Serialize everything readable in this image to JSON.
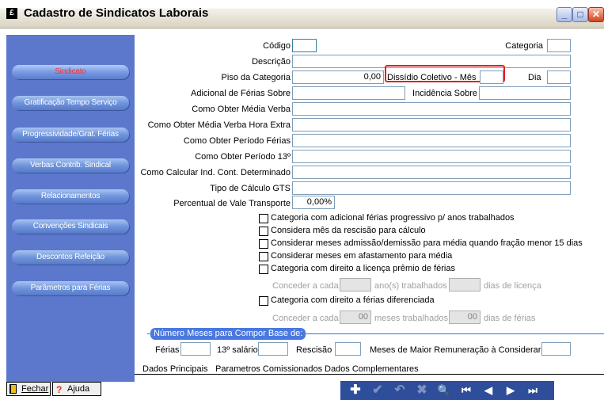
{
  "window": {
    "title": "Cadastro de Sindicatos Laborais",
    "icon_glyph": "£"
  },
  "sidebar": {
    "items": [
      {
        "label": "Sindicato"
      },
      {
        "label": "Gratificação Tempo Serviço"
      },
      {
        "label": "Progressividade/Grat. Férias"
      },
      {
        "label": "Verbas Contrib. Sindical"
      },
      {
        "label": "Relacionamentos"
      },
      {
        "label": "Convenções Sindicais"
      },
      {
        "label": "Descontos Refeição"
      },
      {
        "label": "Parâmetros para Férias"
      }
    ],
    "fechar_label": "Fechar",
    "ajuda_label": "Ajuda"
  },
  "form": {
    "codigo_label": "Código",
    "categoria_label": "Categoria",
    "descricao_label": "Descrição",
    "piso_label": "Piso da Categoria",
    "piso_value": "0,00",
    "dissidio_label": "Dissídio Coletivo - Mês",
    "dia_label": "Dia",
    "adicional_label": "Adicional de Férias Sobre",
    "incidencia_label": "Incidência Sobre",
    "media_verba_label": "Como Obter Média Verba",
    "media_verba_hora_label": "Como Obter Média Verba Hora Extra",
    "periodo_ferias_label": "Como Obter Período Férias",
    "periodo_13_label": "Como Obter Período 13º",
    "ind_cont_label": "Como Calcular Ind. Cont. Determinado",
    "tipo_gts_label": "Tipo de Cálculo GTS",
    "vale_transporte_label": "Percentual de Vale Transporte",
    "vale_transporte_value": "0,00%"
  },
  "checkboxes": [
    "Categoria com adicional férias progressivo p/ anos trabalhados",
    "Considera mês da rescisão para cálculo",
    "Considerar meses admissão/demissão para média quando fração menor 15 dias",
    "Considerar meses em afastamento para média",
    "Categoria com direito a licença prêmio de férias"
  ],
  "licenca": {
    "conceder_label": "Conceder a cada",
    "anos_label": "ano(s) trabalhados",
    "dias_label": "dias de licença"
  },
  "ferias_diferenciada": {
    "checkbox_label": "Categoria com direito a férias diferenciada",
    "conceder_label": "Conceder a cada",
    "meses_value": "00",
    "meses_label": "meses trabalhados",
    "dias_value": "00",
    "dias_label": "dias de férias"
  },
  "base": {
    "group_title": "Número Meses para Compor Base de:",
    "ferias_label": "Férias",
    "decimo_label": "13º salário",
    "rescisao_label": "Rescisão",
    "meses_maior_label": "Meses de Maior Remuneração à Considerar"
  },
  "tabs": [
    "Dados Principais",
    "Parametros Comissionados",
    "Dados Complementares"
  ],
  "toolbar": {
    "icons": [
      "plus-icon",
      "check-icon",
      "undo-icon",
      "delete-icon",
      "search-icon",
      "first-icon",
      "prev-icon",
      "next-icon",
      "last-icon"
    ],
    "glyphs": [
      "✚",
      "✔",
      "↶",
      "✖",
      "🔍",
      "⏮",
      "◀",
      "▶",
      "⏭"
    ]
  }
}
